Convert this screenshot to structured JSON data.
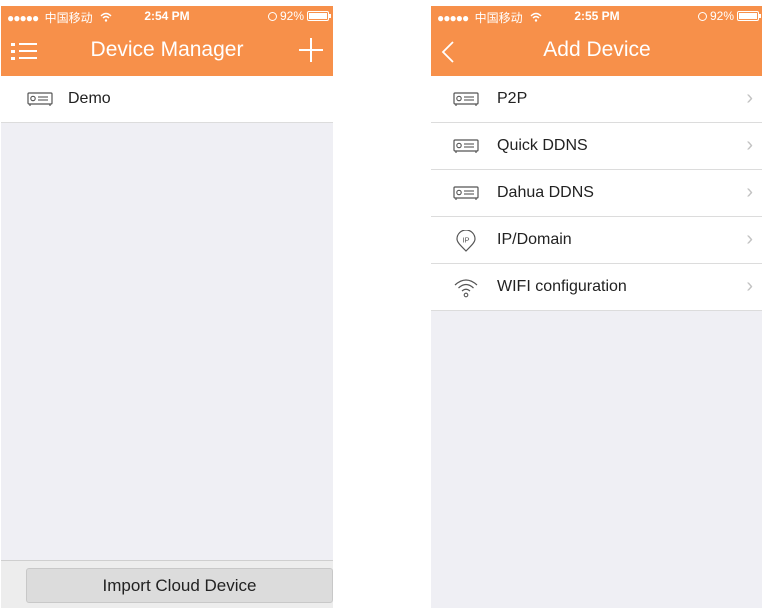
{
  "left_screen": {
    "status": {
      "carrier": "中国移动",
      "time": "2:54 PM",
      "battery": "92%"
    },
    "nav": {
      "title": "Device Manager",
      "left_icon": "menu-icon",
      "right_icon": "plus-icon"
    },
    "devices": [
      {
        "name": "Demo",
        "icon": "dvr-device-icon"
      }
    ],
    "bottom_button": "Import Cloud Device"
  },
  "right_screen": {
    "status": {
      "carrier": "中国移动",
      "time": "2:55 PM",
      "battery": "92%"
    },
    "nav": {
      "title": "Add Device",
      "left_icon": "back-chevron-icon"
    },
    "options": [
      {
        "label": "P2P",
        "icon": "dvr-device-icon"
      },
      {
        "label": "Quick DDNS",
        "icon": "dvr-device-icon"
      },
      {
        "label": "Dahua DDNS",
        "icon": "dvr-device-icon"
      },
      {
        "label": "IP/Domain",
        "icon": "ip-pin-icon"
      },
      {
        "label": "WIFI configuration",
        "icon": "wifi-icon"
      }
    ],
    "chevron": "›"
  },
  "colors": {
    "accent": "#f7904a",
    "background": "#efeff4",
    "separator": "#dcdcdc"
  }
}
